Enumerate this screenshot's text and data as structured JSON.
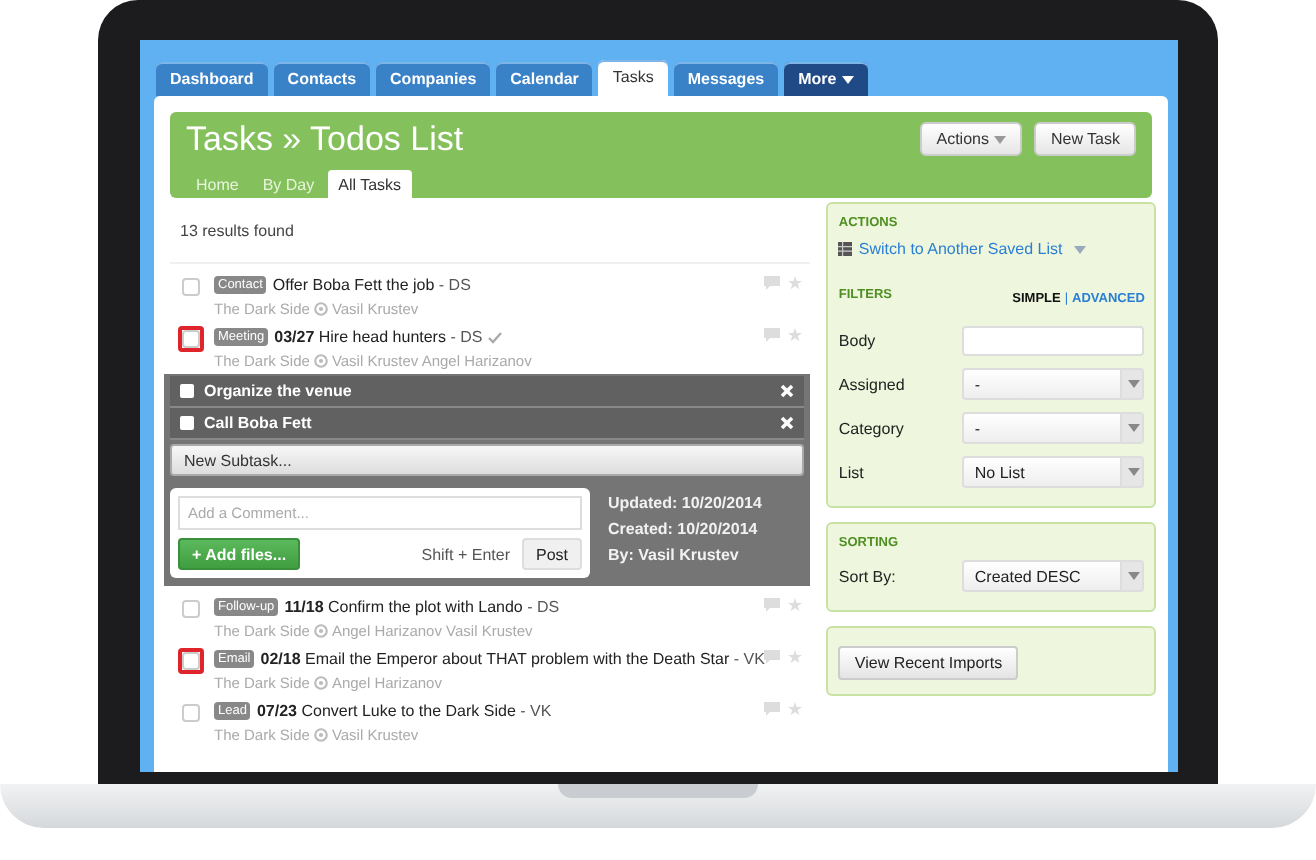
{
  "nav_tabs": [
    {
      "label": "Dashboard",
      "selected": false,
      "kind": "tab"
    },
    {
      "label": "Contacts",
      "selected": false,
      "kind": "tab"
    },
    {
      "label": "Companies",
      "selected": false,
      "kind": "tab"
    },
    {
      "label": "Calendar",
      "selected": false,
      "kind": "tab"
    },
    {
      "label": "Tasks",
      "selected": true,
      "kind": "tab"
    },
    {
      "label": "Messages",
      "selected": false,
      "kind": "tab"
    },
    {
      "label": "More",
      "selected": false,
      "kind": "menu"
    }
  ],
  "header": {
    "title": "Tasks » Todos List",
    "subtabs": [
      {
        "label": "Home",
        "selected": false
      },
      {
        "label": "By Day",
        "selected": false
      },
      {
        "label": "All Tasks",
        "selected": true
      }
    ],
    "buttons": [
      {
        "label": "Actions",
        "dropdown": true
      },
      {
        "label": "New Task",
        "dropdown": false
      }
    ]
  },
  "results_count": "13 results found",
  "tasks": [
    {
      "tag": "Contact",
      "title": "Offer Boba Fett the job",
      "owner": "- DS",
      "verified": false,
      "flagged": false,
      "org": "The Dark Side",
      "people": "Vasil Krustev"
    },
    {
      "tag": "Meeting",
      "date": "03/27",
      "title": "Hire head hunters",
      "owner": "- DS",
      "verified": true,
      "flagged": true,
      "org": "The Dark Side",
      "people": "Vasil Krustev Angel Harizanov",
      "detail": {
        "subtasks": [
          {
            "label": "Organize the venue",
            "checked": false
          },
          {
            "label": "Call Boba Fett",
            "checked": false
          }
        ],
        "new_subtask": "New Subtask...",
        "comment_placeholder": "Add a Comment...",
        "add_files": "+ Add files...",
        "hint": "Shift + Enter",
        "post": "Post",
        "meta": [
          "Updated: 10/20/2014",
          "Created: 10/20/2014",
          "By: Vasil Krustev"
        ]
      }
    },
    {
      "tag": "Follow-up",
      "date": "11/18",
      "title": "Confirm the plot with Lando",
      "owner": "- DS",
      "verified": false,
      "flagged": false,
      "org": "The Dark Side",
      "people": "Angel Harizanov Vasil Krustev"
    },
    {
      "tag": "Email",
      "date": "02/18",
      "title": "Email the Emperor about THAT problem with the Death Star",
      "owner": "- VK",
      "verified": false,
      "flagged": true,
      "org": "The Dark Side",
      "people": "Angel Harizanov"
    },
    {
      "tag": "Lead",
      "date": "07/23",
      "title": "Convert Luke to the Dark Side",
      "owner": "- VK",
      "verified": false,
      "flagged": false,
      "org": "The Dark Side",
      "people": "Vasil Krustev"
    }
  ],
  "sidebar": {
    "actions": {
      "heading": "ACTIONS",
      "link": "Switch to Another Saved List"
    },
    "filters": {
      "heading": "FILTERS",
      "modes": [
        {
          "label": "SIMPLE",
          "selected": true
        },
        {
          "label": "ADVANCED",
          "selected": false
        }
      ],
      "separator": "|",
      "fields": [
        {
          "label": "Body",
          "kind": "text"
        },
        {
          "label": "Assigned",
          "kind": "select",
          "value": "-"
        },
        {
          "label": "Category",
          "kind": "select",
          "value": "-"
        },
        {
          "label": "List",
          "kind": "select",
          "value": "No List"
        }
      ]
    },
    "sorting": {
      "heading": "SORTING",
      "label": "Sort By:",
      "value": "Created DESC"
    },
    "import_button": "View Recent Imports"
  }
}
